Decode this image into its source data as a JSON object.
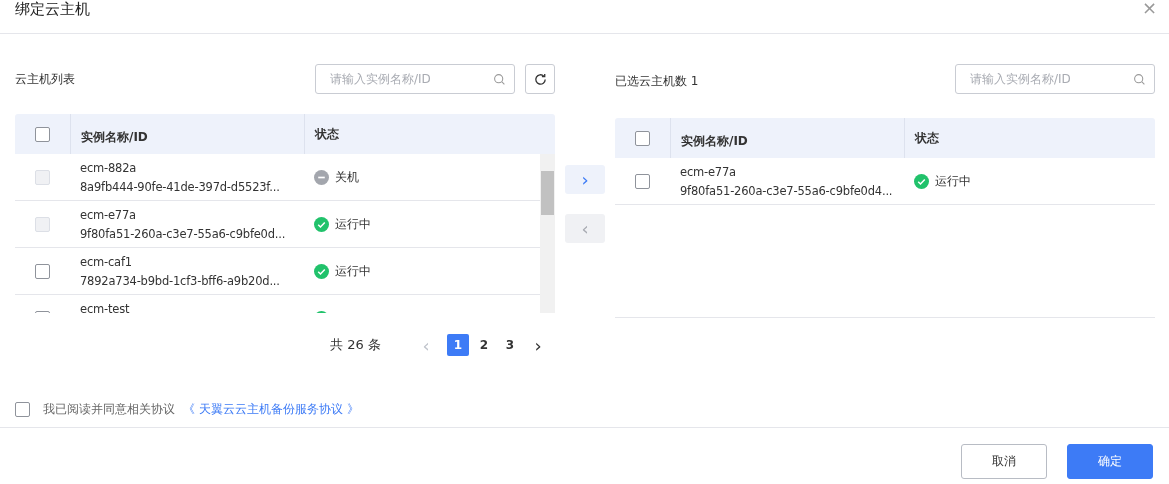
{
  "dialog": {
    "title": "绑定云主机",
    "close": "×"
  },
  "left_panel": {
    "label": "云主机列表",
    "search": {
      "placeholder": "请输入实例名称/ID"
    },
    "table": {
      "header_checked": false,
      "columns": [
        "实例名称/ID",
        "状态"
      ],
      "rows": [
        {
          "name": "ecm-882a",
          "id": "8a9fb444-90fe-41de-397d-d5523f...",
          "status": "关机",
          "kind": "off",
          "checked": false,
          "disabled": true
        },
        {
          "name": "ecm-e77a",
          "id": "9f80fa51-260a-c3e7-55a6-c9bfe0d...",
          "status": "运行中",
          "kind": "running",
          "checked": false,
          "disabled": true
        },
        {
          "name": "ecm-caf1",
          "id": "7892a734-b9bd-1cf3-bff6-a9b20d...",
          "status": "运行中",
          "kind": "running",
          "checked": false,
          "disabled": false
        },
        {
          "name": "ecm-test",
          "kind": "running",
          "checked": false,
          "disabled": false
        }
      ]
    },
    "pagination": {
      "total": "共 26 条",
      "prev": "‹",
      "next": "›",
      "prev_disabled": true,
      "pages": [
        {
          "label": "1",
          "selected": true
        },
        {
          "label": "2",
          "selected": false
        },
        {
          "label": "3",
          "selected": false
        }
      ]
    }
  },
  "transfer": [
    {
      "label": "›",
      "disabled": false
    },
    {
      "label": "‹",
      "disabled": true
    }
  ],
  "right_panel": {
    "label": "已选云主机数 1",
    "search": {
      "placeholder": "请输入实例名称/ID"
    },
    "table": {
      "header_checked": false,
      "columns": [
        "实例名称/ID",
        "状态"
      ],
      "rows": [
        {
          "name": "ecm-e77a",
          "id": "9f80fa51-260a-c3e7-55a6-c9bfe0d4...",
          "status": "运行中",
          "kind": "running",
          "checked": false,
          "disabled": false
        }
      ]
    }
  },
  "agreement": {
    "checked": false,
    "text": "我已阅读并同意相关协议",
    "link": "《 天翼云云主机备份服务协议 》"
  },
  "buttons": [
    {
      "label": "取消",
      "kind": "secondary"
    },
    {
      "label": "确定",
      "kind": "primary"
    }
  ]
}
